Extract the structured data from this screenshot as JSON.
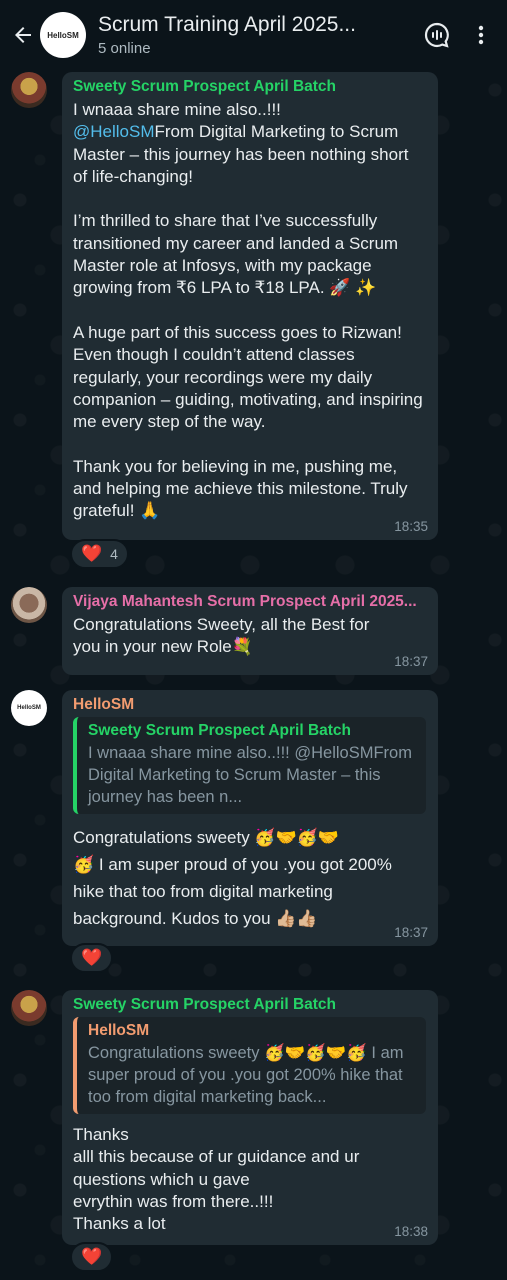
{
  "header": {
    "title": "Scrum Training April 2025...",
    "subtitle": "5 online",
    "avatar_text": "HelloSM"
  },
  "messages": [
    {
      "sender": "Sweety Scrum Prospect April Batch",
      "sender_color": "#25d366",
      "line1": "I wnaaa share mine also..!!!",
      "mention": "@HelloSM",
      "mention_rest": "From Digital Marketing to Scrum Master – this journey has been nothing short of life-changing!",
      "para2": "I’m thrilled to share that I’ve successfully transitioned my career and landed a Scrum Master role at Infosys, with my package growing from ₹6 LPA to ₹18 LPA. 🚀 ✨",
      "para3": "A huge part of this success goes to Rizwan! Even though I couldn’t attend classes regularly, your recordings were my daily companion – guiding, motivating, and inspiring me every step of the way.",
      "para4": "Thank you for believing in me, pushing me, and helping me achieve this milestone. Truly grateful! 🙏",
      "time": "18:35",
      "reaction": "❤️",
      "reaction_count": "4"
    },
    {
      "sender": "Vijaya Mahantesh Scrum Prospect April 2025...",
      "sender_color": "#e66fa8",
      "text": "Congratulations Sweety, all the Best for you in your new Role💐",
      "time": "18:37"
    },
    {
      "sender": "HelloSM",
      "sender_color": "#f29c70",
      "avatar_text": "HelloSM",
      "quote_sender": "Sweety Scrum Prospect April Batch",
      "quote_text": "I wnaaa share mine also..!!! @HelloSMFrom Digital Marketing to Scrum Master – this journey has been n...",
      "text": "Congratulations sweety 🥳🤝🥳🤝\n🥳 I am super proud of you .you got 200% hike that too from digital marketing background. Kudos to you 👍🏼👍🏼",
      "time": "18:37",
      "reaction": "❤️"
    },
    {
      "sender": "Sweety Scrum Prospect April Batch",
      "sender_color": "#25d366",
      "quote_sender": "HelloSM",
      "quote_text": "Congratulations sweety 🥳🤝🥳🤝🥳 I am super proud of you .you got 200% hike that too from digital marketing back...",
      "text": "Thanks\nalll this because of ur guidance and ur questions which u gave\nevrythin was from there..!!!\nThanks a lot",
      "time": "18:38",
      "reaction": "❤️"
    }
  ]
}
